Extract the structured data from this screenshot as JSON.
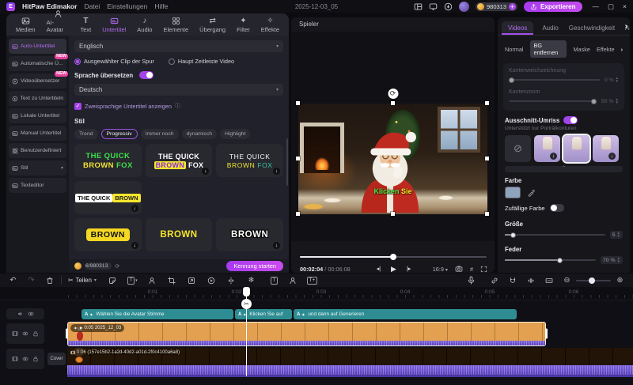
{
  "titlebar": {
    "app_name": "HitPaw Edimakor",
    "menus": [
      "Datei",
      "Einstellungen",
      "Hilfe"
    ],
    "document_title": "2025-12-03_05",
    "credits": "980313",
    "export_label": "Exportieren"
  },
  "ribbon": {
    "active_tab": "Untertitel",
    "tabs": [
      {
        "label": "Medien"
      },
      {
        "label": "AI-Avatar"
      },
      {
        "label": "Text"
      },
      {
        "label": "Untertitel"
      },
      {
        "label": "Audio"
      },
      {
        "label": "Elemente"
      },
      {
        "label": "Übergang"
      },
      {
        "label": "Filter"
      },
      {
        "label": "Effekte"
      }
    ]
  },
  "sidebar": {
    "items": [
      {
        "label": "Auto-Untertitel"
      },
      {
        "label": "Automatische Ü...",
        "badge": "NEW"
      },
      {
        "label": "Videoübersetzer",
        "badge": "NEW"
      },
      {
        "label": "Text zu Untertiteln"
      },
      {
        "label": "Lokale Untertitel"
      },
      {
        "label": "Manual Untertitel"
      },
      {
        "label": "Benutzerdefiniert"
      },
      {
        "label": "Stil"
      },
      {
        "label": "Texteditor"
      }
    ]
  },
  "subtitle_panel": {
    "source_language": "Englisch",
    "radio_clip": "Ausgewählter Clip der Spur",
    "radio_timeline": "Haupt Zeitleiste Video",
    "translate_label": "Sprache übersetzen",
    "target_language": "Deutsch",
    "bilingual_label": "Zweisprachige Untertitel anzeigen",
    "style_section": "Stil",
    "active_style_tab": "Progressiv",
    "style_tabs": [
      "Trend",
      "Progressiv",
      "Immer noch",
      "dynamisch",
      "Highlight"
    ],
    "presets": [
      {
        "t1": "THE QUICK",
        "t2": "BROWN",
        "t3": "FOX"
      },
      {
        "t1": "THE QUICK",
        "t2": "BROWN",
        "t3": "FOX"
      },
      {
        "t1": "THE QUICK",
        "t2": "BROWN",
        "t3": "FOX"
      },
      {
        "t1": "THE QUICK",
        "t2": "BROWN"
      },
      {
        "t1": "BROWN"
      },
      {
        "t1": "BROWN"
      },
      {
        "t1": "BROWN"
      }
    ],
    "credit_usage": "6/980313",
    "start_button": "Kennung starten"
  },
  "player": {
    "title": "Spieler",
    "overlay_subtitle_1": "Klicken",
    "overlay_subtitle_2": "Sie",
    "current_time": "00:02:04",
    "duration": "00:06:08",
    "aspect_ratio": "16:9"
  },
  "properties": {
    "tabs": [
      "Videos",
      "Audio",
      "Geschwindigkeit",
      "An"
    ],
    "active_tab": "Videos",
    "subtabs": [
      "Normal",
      "BG entfernen",
      "Maske",
      "Effekte"
    ],
    "active_subtab": "BG entfernen",
    "edge_feather_label": "Kantenweichzeichnung",
    "edge_feather_value": "0 %",
    "edge_zoom_label": "Kantenzoom",
    "edge_zoom_value": "50 %",
    "outline_label": "Ausschnitt-Umriss",
    "outline_hint": "Unterstützt nur Porträtkonturen",
    "color_label": "Farbe",
    "random_color_label": "Zufällige Farbe",
    "size_label": "Größe",
    "size_value": "5",
    "feather_label": "Feder",
    "feather_value": "70 %"
  },
  "timeline": {
    "split_label": "Teilen",
    "cover_label": "Cover",
    "ruler": [
      "0:01",
      "0:02",
      "0:03",
      "0:04",
      "0:05",
      "0:06"
    ],
    "clip_icon": "A",
    "subtitle_clips": [
      "Wählen Sie die Avatar Stimme",
      "Klicken Sie auf",
      "und dann auf Generieren"
    ],
    "video_clip_label": "0:05 2025_12_03",
    "audio_clip_label": "0:06 (157e15b2-1a2d-40d2-a01d-2f0c4100a6a8)"
  },
  "glyphs": {
    "chevron_down": "▾",
    "chevron_right": "›",
    "chevron_up": "⌃",
    "undo": "↶",
    "redo": "↷",
    "scissors": "✂",
    "snowflake": "❄",
    "keyframe": "◈",
    "note": "♪",
    "transition": "⇄",
    "filter": "✦",
    "effects": "✧",
    "zoom_in": "⊕",
    "zoom_out": "⊖",
    "refresh": "⟳",
    "download": "↓",
    "check": "✓",
    "info": "ⓘ",
    "block": "⊘",
    "plus": "+",
    "minimize": "—",
    "maximize": "▢",
    "close": "×",
    "grid": "#",
    "play": "▶",
    "prev": "◂|",
    "next": "|▸",
    "text_t": "T",
    "text_t_plus": "T+",
    "rotate": "⟳",
    "up_arrow": "↑",
    "dot_sep": "/",
    "stepper_up": "▲",
    "stepper_down": "▼"
  },
  "colors": {
    "accent_purple": "#a555ec",
    "export_button": "#b03af0",
    "teal_clip": "#2e8d92",
    "orange_clip": "#e2a050",
    "waveform_purple": "#6c52ce",
    "new_badge": "#e8409c",
    "style_yellow": "#f0e332",
    "style_green": "#3fe04c",
    "swatch_color": "#8fa3bd"
  }
}
